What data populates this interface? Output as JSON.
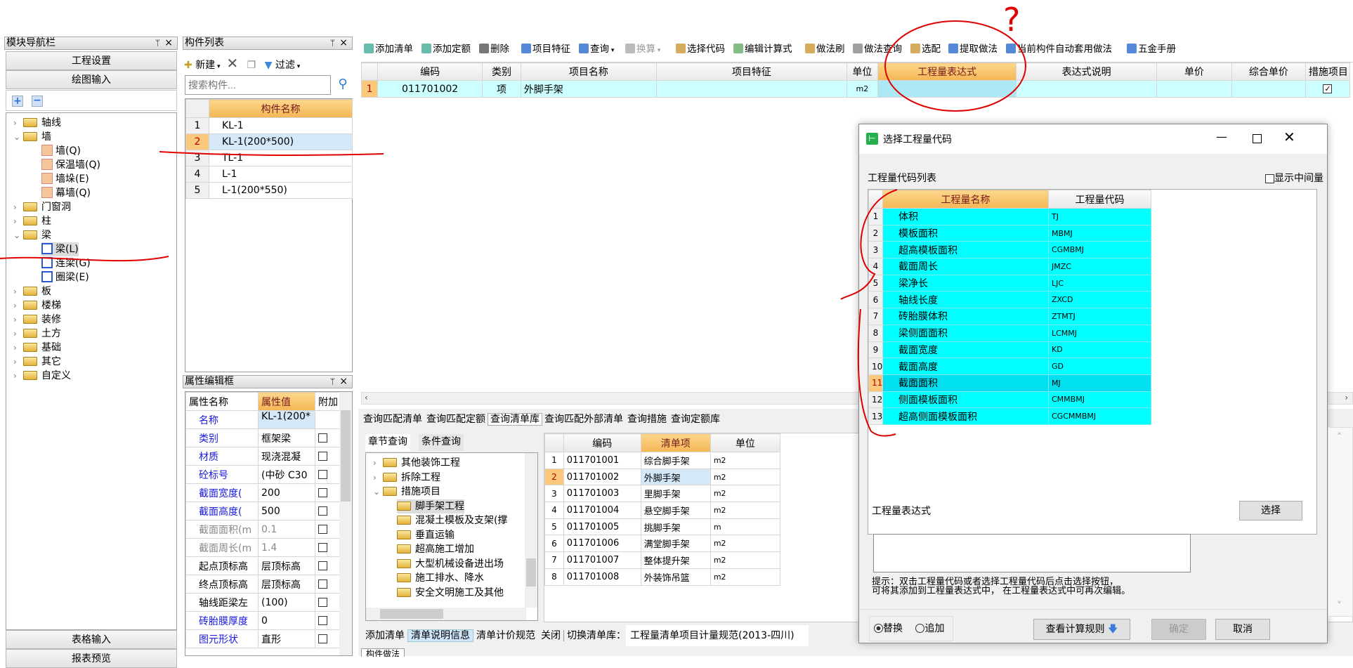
{
  "nav": {
    "title": "模块导航栏",
    "pin": "ᛘ",
    "close": "×",
    "project_settings": "工程设置",
    "drawing_input": "绘图输入",
    "table_input": "表格输入",
    "report_preview": "报表预览",
    "tree": [
      {
        "label": "轴线",
        "open": false
      },
      {
        "label": "墙",
        "open": true,
        "children": [
          "墙(Q)",
          "保温墙(Q)",
          "墙垛(E)",
          "幕墙(Q)"
        ]
      },
      {
        "label": "门窗洞",
        "open": false
      },
      {
        "label": "柱",
        "open": false
      },
      {
        "label": "梁",
        "open": true,
        "children": [
          "梁(L)",
          "连梁(G)",
          "圈梁(E)"
        ]
      },
      {
        "label": "板"
      },
      {
        "label": "楼梯"
      },
      {
        "label": "装修"
      },
      {
        "label": "土方"
      },
      {
        "label": "基础"
      },
      {
        "label": "其它"
      },
      {
        "label": "自定义"
      }
    ]
  },
  "components": {
    "title": "构件列表",
    "new": "新建",
    "filter": "过滤",
    "search_placeholder": "搜索构件...",
    "header": "构件名称",
    "rows": [
      "KL-1",
      "KL-1(200*500)",
      "TL-1",
      "L-1",
      "L-1(200*550)"
    ],
    "selected": 2
  },
  "props": {
    "title": "属性编辑框",
    "headers": [
      "属性名称",
      "属性值",
      "附加"
    ],
    "rows": [
      {
        "name": "名称",
        "value": "KL-1(200*",
        "style": "blue",
        "cb": false
      },
      {
        "name": "类别",
        "value": "框架梁",
        "style": "blue",
        "cb": true
      },
      {
        "name": "材质",
        "value": "现浇混凝",
        "style": "blue",
        "cb": true
      },
      {
        "name": "砼标号",
        "value": "(中砂 C30",
        "style": "blue",
        "cb": true
      },
      {
        "name": "截面宽度(",
        "value": "200",
        "style": "blue",
        "cb": true
      },
      {
        "name": "截面高度(",
        "value": "500",
        "style": "blue",
        "cb": true
      },
      {
        "name": "截面面积(m",
        "value": "0.1",
        "style": "gray",
        "cb": true
      },
      {
        "name": "截面周长(m",
        "value": "1.4",
        "style": "gray",
        "cb": true
      },
      {
        "name": "起点顶标高",
        "value": "层顶标高",
        "style": "",
        "cb": true
      },
      {
        "name": "终点顶标高",
        "value": "层顶标高",
        "style": "",
        "cb": true
      },
      {
        "name": "轴线距梁左",
        "value": "(100)",
        "style": "",
        "cb": true
      },
      {
        "name": "砖胎膜厚度",
        "value": "0",
        "style": "blue",
        "cb": true
      },
      {
        "name": "图元形状",
        "value": "直形",
        "style": "blue",
        "cb": true
      }
    ]
  },
  "toolbar": [
    "添加清单",
    "添加定额",
    "删除",
    "项目特征",
    "查询",
    "换算",
    "选择代码",
    "编辑计算式",
    "做法刷",
    "做法查询",
    "选配",
    "提取做法",
    "当前构件自动套用做法",
    "五金手册"
  ],
  "main_grid": {
    "headers": [
      "编码",
      "类别",
      "项目名称",
      "项目特征",
      "单位",
      "工程量表达式",
      "表达式说明",
      "单价",
      "综合单价",
      "措施项目"
    ],
    "rows": [
      {
        "num": "1",
        "code": "011701002",
        "type": "项",
        "name": "外脚手架",
        "feature": "",
        "unit": "m2",
        "expr": "",
        "desc": "",
        "price": "",
        "total": "",
        "measure": true
      }
    ]
  },
  "query": {
    "tabs": [
      "查询匹配清单",
      "查询匹配定额",
      "查询清单库",
      "查询匹配外部清单",
      "查询措施",
      "查询定额库"
    ],
    "active_tab": 2,
    "subtabs": [
      "章节查询",
      "条件查询"
    ],
    "tree": [
      {
        "label": "其他装饰工程",
        "level": 0,
        "chev": "›"
      },
      {
        "label": "拆除工程",
        "level": 0,
        "chev": "›"
      },
      {
        "label": "措施项目",
        "level": 0,
        "chev": "⌄"
      },
      {
        "label": "脚手架工程",
        "level": 1
      },
      {
        "label": "混凝土模板及支架(撑",
        "level": 1
      },
      {
        "label": "垂直运输",
        "level": 1
      },
      {
        "label": "超高施工增加",
        "level": 1
      },
      {
        "label": "大型机械设备进出场",
        "level": 1
      },
      {
        "label": "施工排水、降水",
        "level": 1
      },
      {
        "label": "安全文明施工及其他",
        "level": 1
      }
    ],
    "headers": [
      "编码",
      "清单项",
      "单位"
    ],
    "rows": [
      [
        "011701001",
        "综合脚手架",
        "m2"
      ],
      [
        "011701002",
        "外脚手架",
        "m2"
      ],
      [
        "011701003",
        "里脚手架",
        "m2"
      ],
      [
        "011701004",
        "悬空脚手架",
        "m2"
      ],
      [
        "011701005",
        "挑脚手架",
        "m"
      ],
      [
        "011701006",
        "满堂脚手架",
        "m2"
      ],
      [
        "011701007",
        "整体提升架",
        "m2"
      ],
      [
        "011701008",
        "外装饰吊篮",
        "m2"
      ]
    ],
    "bottom": [
      "添加清单",
      "清单说明信息",
      "清单计价规范",
      "关闭"
    ],
    "switch_label": "切换清单库：",
    "library": "工程量清单项目计量规范(2013-四川)",
    "bottom_tab": "构件做法"
  },
  "dialog": {
    "title": "选择工程量代码",
    "list_label": "工程量代码列表",
    "show_intermediate": "显示中间量",
    "headers": [
      "工程量名称",
      "工程量代码"
    ],
    "rows": [
      [
        "体积",
        "TJ"
      ],
      [
        "模板面积",
        "MBMJ"
      ],
      [
        "超高模板面积",
        "CGMBMJ"
      ],
      [
        "截面周长",
        "JMZC"
      ],
      [
        "梁净长",
        "LJC"
      ],
      [
        "轴线长度",
        "ZXCD"
      ],
      [
        "砖胎膜体积",
        "ZTMTJ"
      ],
      [
        "梁侧面面积",
        "LCMMJ"
      ],
      [
        "截面宽度",
        "KD"
      ],
      [
        "截面高度",
        "GD"
      ],
      [
        "截面面积",
        "MJ"
      ],
      [
        "侧面模板面积",
        "CMMBMJ"
      ],
      [
        "超高侧面模板面积",
        "CGCMMBMJ"
      ]
    ],
    "selected": 11,
    "expr_label": "工程量表达式",
    "select_btn": "选择",
    "expr_value": "",
    "hint1": "提示：双击工程量代码或者选择工程量代码后点击选择按钮，",
    "hint2": "可将其添加到工程量表达式中， 在工程量表达式中可再次编辑。",
    "replace": "替换",
    "append": "追加",
    "mode": "替换",
    "rules_btn": "查看计算规则",
    "ok": "确定",
    "cancel": "取消"
  },
  "annotation": {
    "question_mark": "?",
    "color": "#e00000"
  },
  "colors": {
    "cyan": "#00ffff",
    "header_sel": "#f3b655",
    "row_sel": "#d4e8f8",
    "main_row": "#ccffff"
  }
}
